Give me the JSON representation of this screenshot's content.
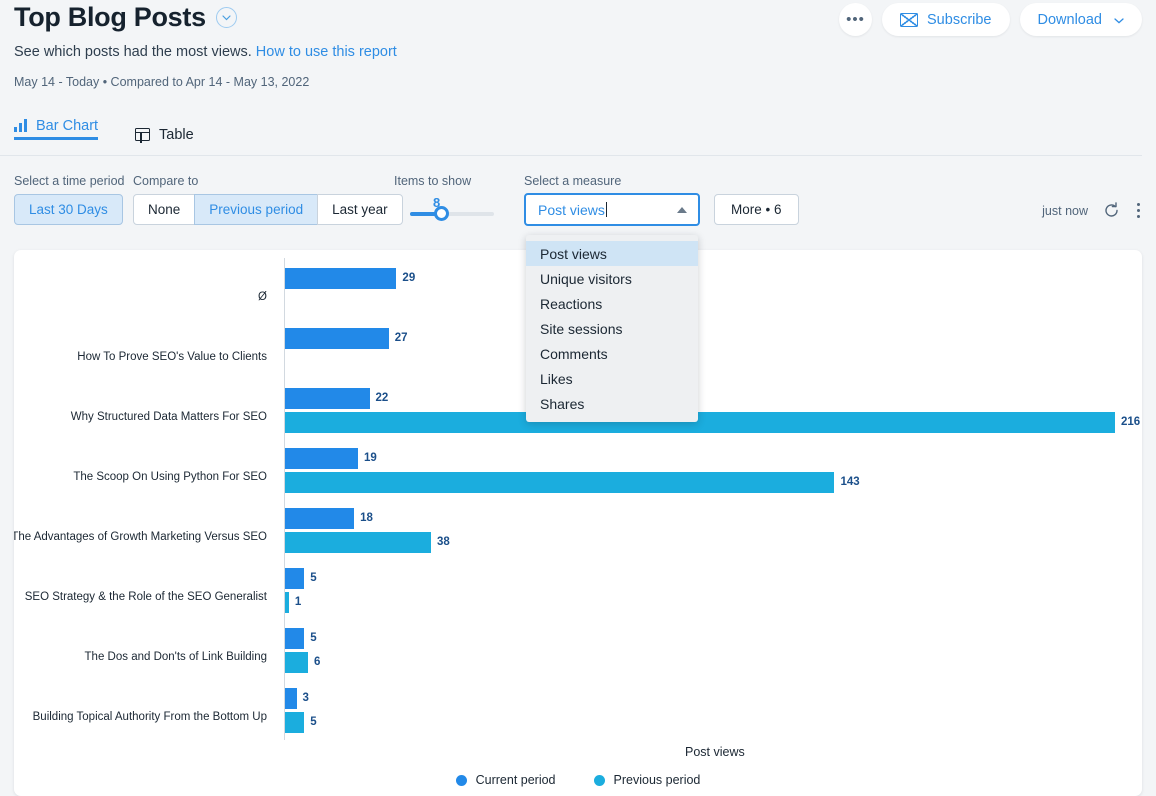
{
  "header": {
    "title": "Top Blog Posts",
    "title_caret_icon": "chevron-down-circle-icon",
    "subtitle_text": "See which posts had the most views.",
    "subtitle_link": "How to use this report",
    "date_range": "May 14 - Today  •  Compared to Apr 14 - May 13, 2022",
    "more_label": "•••",
    "subscribe_label": "Subscribe",
    "subscribe_icon": "envelope-icon",
    "download_label": "Download",
    "download_caret_icon": "chevron-down-icon"
  },
  "tabs": [
    {
      "label": "Bar Chart",
      "icon": "bar-chart-icon",
      "active": true
    },
    {
      "label": "Table",
      "icon": "table-icon",
      "active": false
    }
  ],
  "controls": {
    "time_period_label": "Select a time period",
    "time_period_value": "Last 30 Days",
    "compare_label": "Compare to",
    "compare_options": [
      "None",
      "Previous period",
      "Last year"
    ],
    "compare_selected": "Previous period",
    "items_label": "Items to show",
    "items_value": "8",
    "measure_label": "Select a measure",
    "measure_value": "Post views",
    "measure_caret_icon": "caret-up-icon",
    "more_button_label": "More • 6",
    "refresh_status": "just now",
    "refresh_icon": "refresh-icon",
    "kebab_icon": "kebab-menu-icon"
  },
  "dropdown": {
    "options": [
      "Post views",
      "Unique visitors",
      "Reactions",
      "Site sessions",
      "Comments",
      "Likes",
      "Shares"
    ],
    "selected": "Post views"
  },
  "colors": {
    "current": "#2289e8",
    "previous": "#1badde",
    "accent": "#2f8de4",
    "value_text": "#1b4f8a"
  },
  "chart_data": {
    "type": "bar",
    "orientation": "horizontal",
    "title": "",
    "xlabel": "Post views",
    "ylabel": "",
    "categories": [
      "Ø",
      "How To Prove SEO's Value to Clients",
      "Why Structured Data Matters For SEO",
      "The Scoop On Using Python For SEO",
      "The Advantages of Growth Marketing Versus SEO",
      "SEO Strategy & the Role of the SEO Generalist",
      "The Dos and Don'ts of Link Building",
      "Building Topical Authority From the Bottom Up"
    ],
    "series": [
      {
        "name": "Current period",
        "color": "#2289e8",
        "values": [
          29,
          27,
          22,
          19,
          18,
          5,
          5,
          3
        ]
      },
      {
        "name": "Previous period",
        "color": "#1badde",
        "values": [
          null,
          null,
          216,
          143,
          38,
          1,
          6,
          5
        ]
      }
    ],
    "legend": [
      "Current period",
      "Previous period"
    ],
    "legend_position": "bottom",
    "xlim": [
      0,
      216
    ],
    "grid": false
  }
}
